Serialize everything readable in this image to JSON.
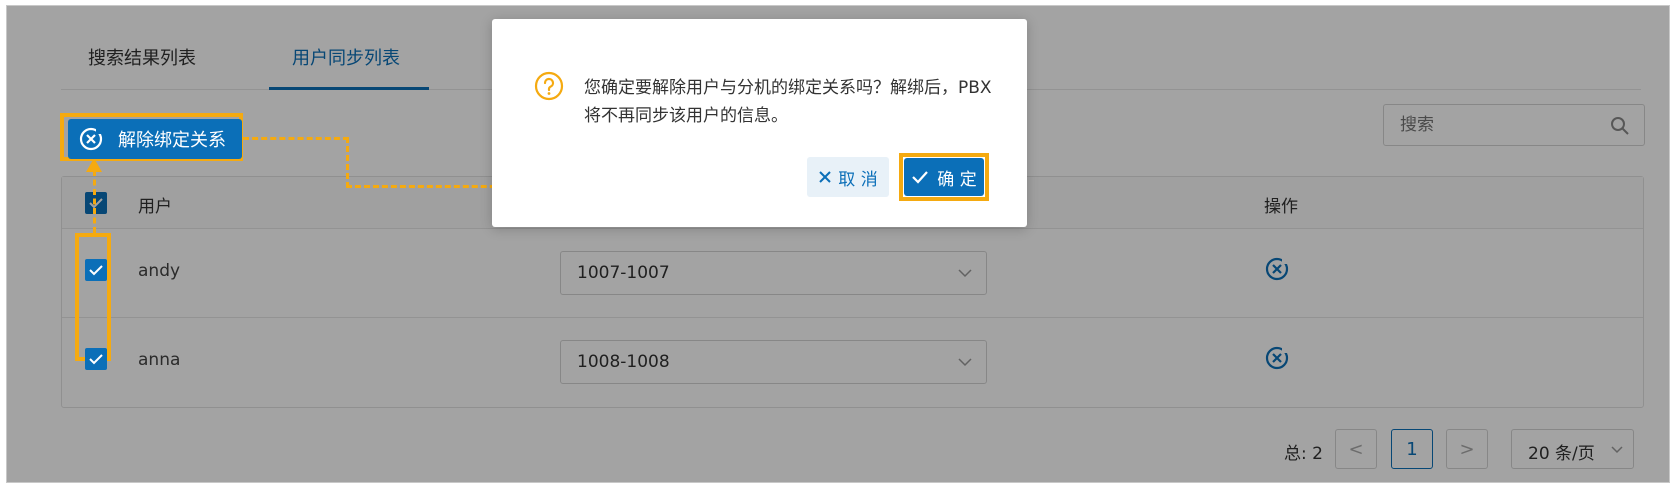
{
  "tabs": [
    {
      "label": "搜索结果列表"
    },
    {
      "label": "用户同步列表"
    }
  ],
  "toolbar": {
    "unbind_label": "解除绑定关系",
    "search_placeholder": "搜索"
  },
  "table": {
    "headers": {
      "user": "用户",
      "actions": "操作"
    },
    "rows": [
      {
        "user": "andy",
        "extension": "1007-1007"
      },
      {
        "user": "anna",
        "extension": "1008-1008"
      }
    ]
  },
  "pagination": {
    "total": "总: 2",
    "current_page": "1",
    "prev": "<",
    "next": ">",
    "page_size": "20 条/页"
  },
  "dialog": {
    "message": "您确定要解除用户与分机的绑定关系吗？解绑后，PBX将不再同步该用户的信息。",
    "cancel_label": "取 消",
    "ok_label": "确 定"
  },
  "colors": {
    "primary": "#0b6fb8",
    "highlight": "#f5aa10",
    "warning_icon": "#f5aa10"
  }
}
